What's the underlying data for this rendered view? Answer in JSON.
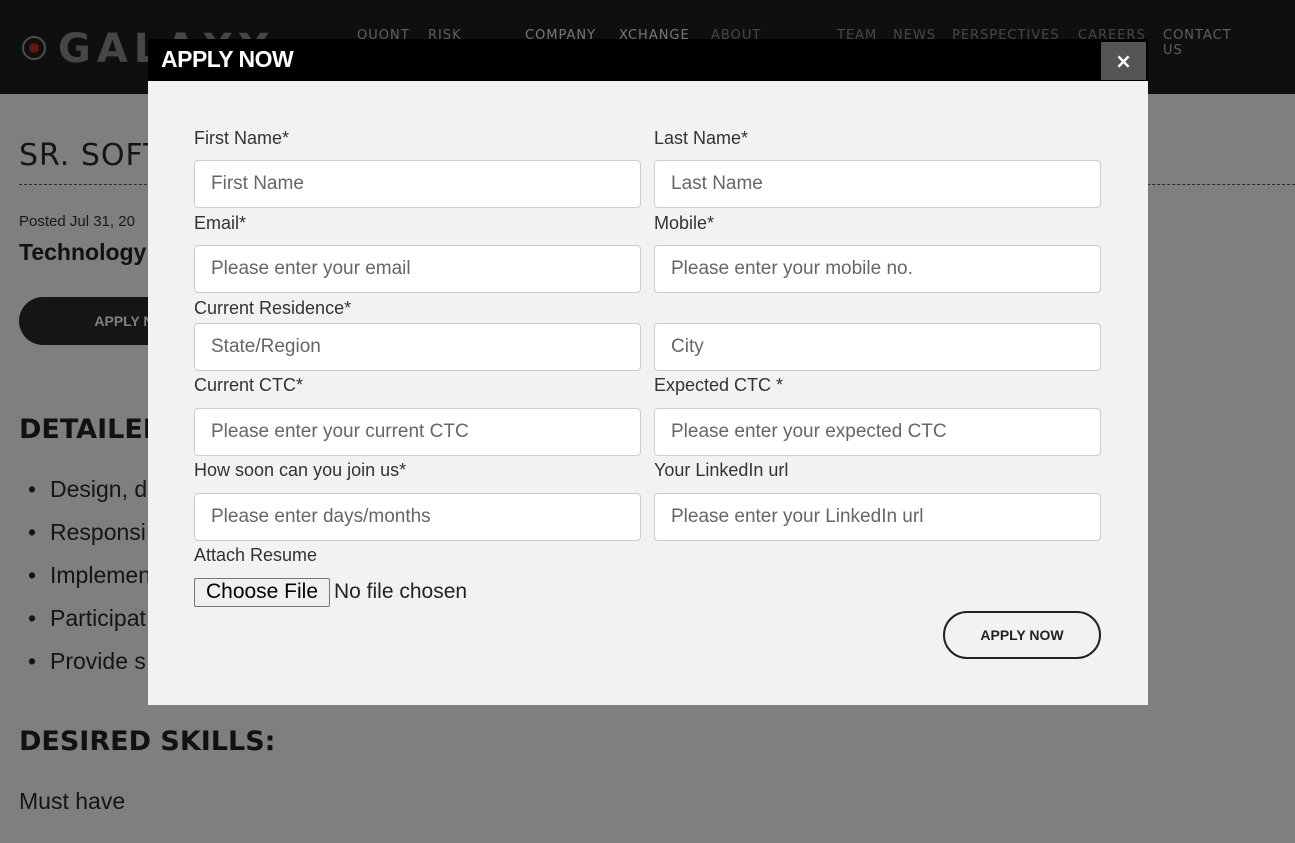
{
  "brand": {
    "logo_text": "GALAXY"
  },
  "nav": {
    "items": [
      {
        "line1": "QUONT",
        "line2": ""
      },
      {
        "line1": "RISK",
        "line2": ""
      },
      {
        "line1": "COMPANY",
        "line2": ""
      },
      {
        "line1": "XCHANGE",
        "line2": ""
      },
      {
        "line1": "ABOUT",
        "line2": ""
      },
      {
        "line1": "TEAM",
        "line2": ""
      },
      {
        "line1": "NEWS",
        "line2": ""
      },
      {
        "line1": "PERSPECTIVES",
        "line2": ""
      },
      {
        "line1": "CAREERS",
        "line2": ""
      },
      {
        "line1": "CONTACT",
        "line2": "US"
      }
    ]
  },
  "job": {
    "title": "SR. SOFTWARE ENGINEER",
    "posted": "Posted Jul 31, 20",
    "department": "Technology",
    "apply_label": "APPLY NOW",
    "detailed_heading": "DETAILED",
    "duties": [
      "Design, d",
      "Responsi",
      "Implemen",
      "Participat",
      "Provide s"
    ],
    "desired_heading": "DESIRED SKILLS:",
    "must_have": "Must have"
  },
  "modal": {
    "title": "APPLY NOW",
    "close_label": "×",
    "labels": {
      "first_name": "First Name*",
      "last_name": "Last Name*",
      "email": "Email*",
      "mobile": "Mobile*",
      "residence": "Current Residence*",
      "current_ctc": "Current CTC*",
      "expected_ctc": "Expected CTC *",
      "join": "How soon can you join us*",
      "linkedin": "Your LinkedIn url",
      "resume": "Attach Resume"
    },
    "placeholders": {
      "first_name": "First Name",
      "last_name": "Last Name",
      "email": "Please enter your email",
      "mobile": "Please enter your mobile no.",
      "state": "State/Region",
      "city": "City",
      "current_ctc": "Please enter your current CTC",
      "expected_ctc": "Please enter your expected CTC",
      "join": "Please enter days/months",
      "linkedin": "Please enter your LinkedIn url"
    },
    "file_button": "Choose File",
    "file_status": "No file chosen",
    "submit_label": "APPLY NOW"
  }
}
